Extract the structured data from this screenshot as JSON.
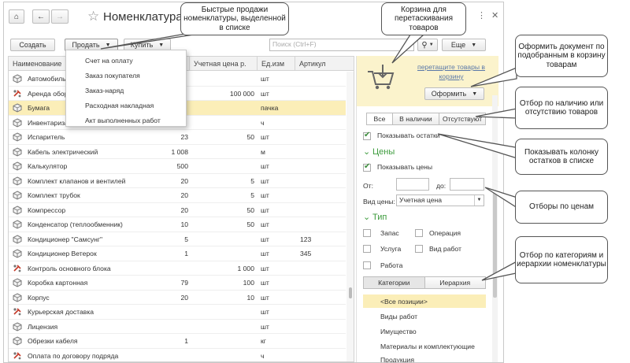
{
  "window": {
    "title": "Номенклатура",
    "home_icon": "home-icon",
    "back_icon": "arrow-left-icon",
    "forward_icon": "arrow-right-icon",
    "star_icon": "star-icon",
    "menu_icon": "dots-icon",
    "close_icon": "close-icon"
  },
  "toolbar": {
    "create": "Создать",
    "sell": "Продать",
    "buy": "Купить",
    "search_placeholder": "Поиск (Ctrl+F)",
    "search_icon": "search-icon",
    "more": "Еще"
  },
  "sell_menu": [
    "Счет на оплату",
    "Заказ покупателя",
    "Заказ-наряд",
    "Расходная накладная",
    "Акт выполненных работ"
  ],
  "table": {
    "columns": [
      "Наименование",
      "",
      "Учетная цена р.",
      "Ед.изм",
      "Артикул"
    ],
    "rows": [
      {
        "icon": "product",
        "name": "Автомобиль",
        "qty": "",
        "price": "",
        "unit": "шт",
        "sku": ""
      },
      {
        "icon": "service",
        "name": "Аренда оборудования",
        "qty": "",
        "price": "100 000",
        "unit": "шт",
        "sku": ""
      },
      {
        "icon": "product",
        "name": "Бумага",
        "qty": "",
        "price": "",
        "unit": "пачка",
        "sku": "",
        "selected": true
      },
      {
        "icon": "product",
        "name": "Инвентаризация",
        "qty": "",
        "price": "",
        "unit": "ч",
        "sku": ""
      },
      {
        "icon": "product",
        "name": "Испаритель",
        "qty": "23",
        "price": "50",
        "unit": "шт",
        "sku": ""
      },
      {
        "icon": "product",
        "name": "Кабель электрический",
        "qty": "1 008",
        "price": "",
        "unit": "м",
        "sku": ""
      },
      {
        "icon": "product",
        "name": "Калькулятор",
        "qty": "500",
        "price": "",
        "unit": "шт",
        "sku": ""
      },
      {
        "icon": "product",
        "name": "Комплект клапанов и вентилей",
        "qty": "20",
        "price": "5",
        "unit": "шт",
        "sku": ""
      },
      {
        "icon": "product",
        "name": "Комплект трубок",
        "qty": "20",
        "price": "5",
        "unit": "шт",
        "sku": ""
      },
      {
        "icon": "product",
        "name": "Компрессор",
        "qty": "20",
        "price": "50",
        "unit": "шт",
        "sku": ""
      },
      {
        "icon": "product",
        "name": "Конденсатор (теплообменник)",
        "qty": "10",
        "price": "50",
        "unit": "шт",
        "sku": ""
      },
      {
        "icon": "product",
        "name": "Кондиционер \"Самсунг\"",
        "qty": "5",
        "price": "",
        "unit": "шт",
        "sku": "123"
      },
      {
        "icon": "product",
        "name": "Кондиционер Ветерок",
        "qty": "1",
        "price": "",
        "unit": "шт",
        "sku": "345"
      },
      {
        "icon": "service",
        "name": "Контроль основного блока",
        "qty": "",
        "price": "1 000",
        "unit": "шт",
        "sku": ""
      },
      {
        "icon": "product",
        "name": "Коробка картонная",
        "qty": "79",
        "price": "100",
        "unit": "шт",
        "sku": ""
      },
      {
        "icon": "product",
        "name": "Корпус",
        "qty": "20",
        "price": "10",
        "unit": "шт",
        "sku": ""
      },
      {
        "icon": "service",
        "name": "Курьерская доставка",
        "qty": "",
        "price": "",
        "unit": "шт",
        "sku": ""
      },
      {
        "icon": "product",
        "name": "Лицензия",
        "qty": "",
        "price": "",
        "unit": "шт",
        "sku": ""
      },
      {
        "icon": "product",
        "name": "Обрезки кабеля",
        "qty": "1",
        "price": "",
        "unit": "кг",
        "sku": ""
      },
      {
        "icon": "service",
        "name": "Оплата по договору подряда",
        "qty": "",
        "price": "",
        "unit": "ч",
        "sku": ""
      },
      {
        "icon": "product",
        "name": "",
        "qty": "",
        "price": "",
        "unit": "",
        "sku": ""
      }
    ]
  },
  "panel": {
    "drop_hint": "перетащите товары в корзину",
    "cart_icon": "cart-icon",
    "checkout": "Оформить",
    "availability_tabs": [
      "Все",
      "В наличии",
      "Отсутствуют"
    ],
    "show_stock": "Показывать остатки",
    "prices_header": "Цены",
    "show_prices": "Показывать цены",
    "from_label": "От:",
    "to_label": "до:",
    "price_type_label": "Вид цены:",
    "price_type_value": "Учетная цена",
    "type_header": "Тип",
    "types": [
      "Запас",
      "Операция",
      "Услуга",
      "Вид работ",
      "Работа"
    ],
    "category_tabs": [
      "Категории",
      "Иерархия"
    ],
    "categories": [
      "<Все позиции>",
      "Виды работ",
      "Имущество",
      "Материалы и комплектующие",
      "Продукция"
    ]
  },
  "callouts": {
    "quick_sale": "Быстрые продажи номенклатуры, выделенной в списке",
    "cart": "Корзина для перетаскивания товаров",
    "checkout_doc": "Оформить документ по подобранным в корзину товарам",
    "availability": "Отбор по наличию или отсутствию товаров",
    "stock_column": "Показывать колонку остатков в списке",
    "price_filter": "Отборы по ценам",
    "category_filter": "Отбор по категориям и иерархии номенклатуры"
  },
  "colors": {
    "selected_row": "#fbeeb8",
    "cart_zone": "#fbf3cc",
    "link": "#5a78a8",
    "header_green": "#3c9b3c",
    "service_icon": "#c43b2b"
  }
}
